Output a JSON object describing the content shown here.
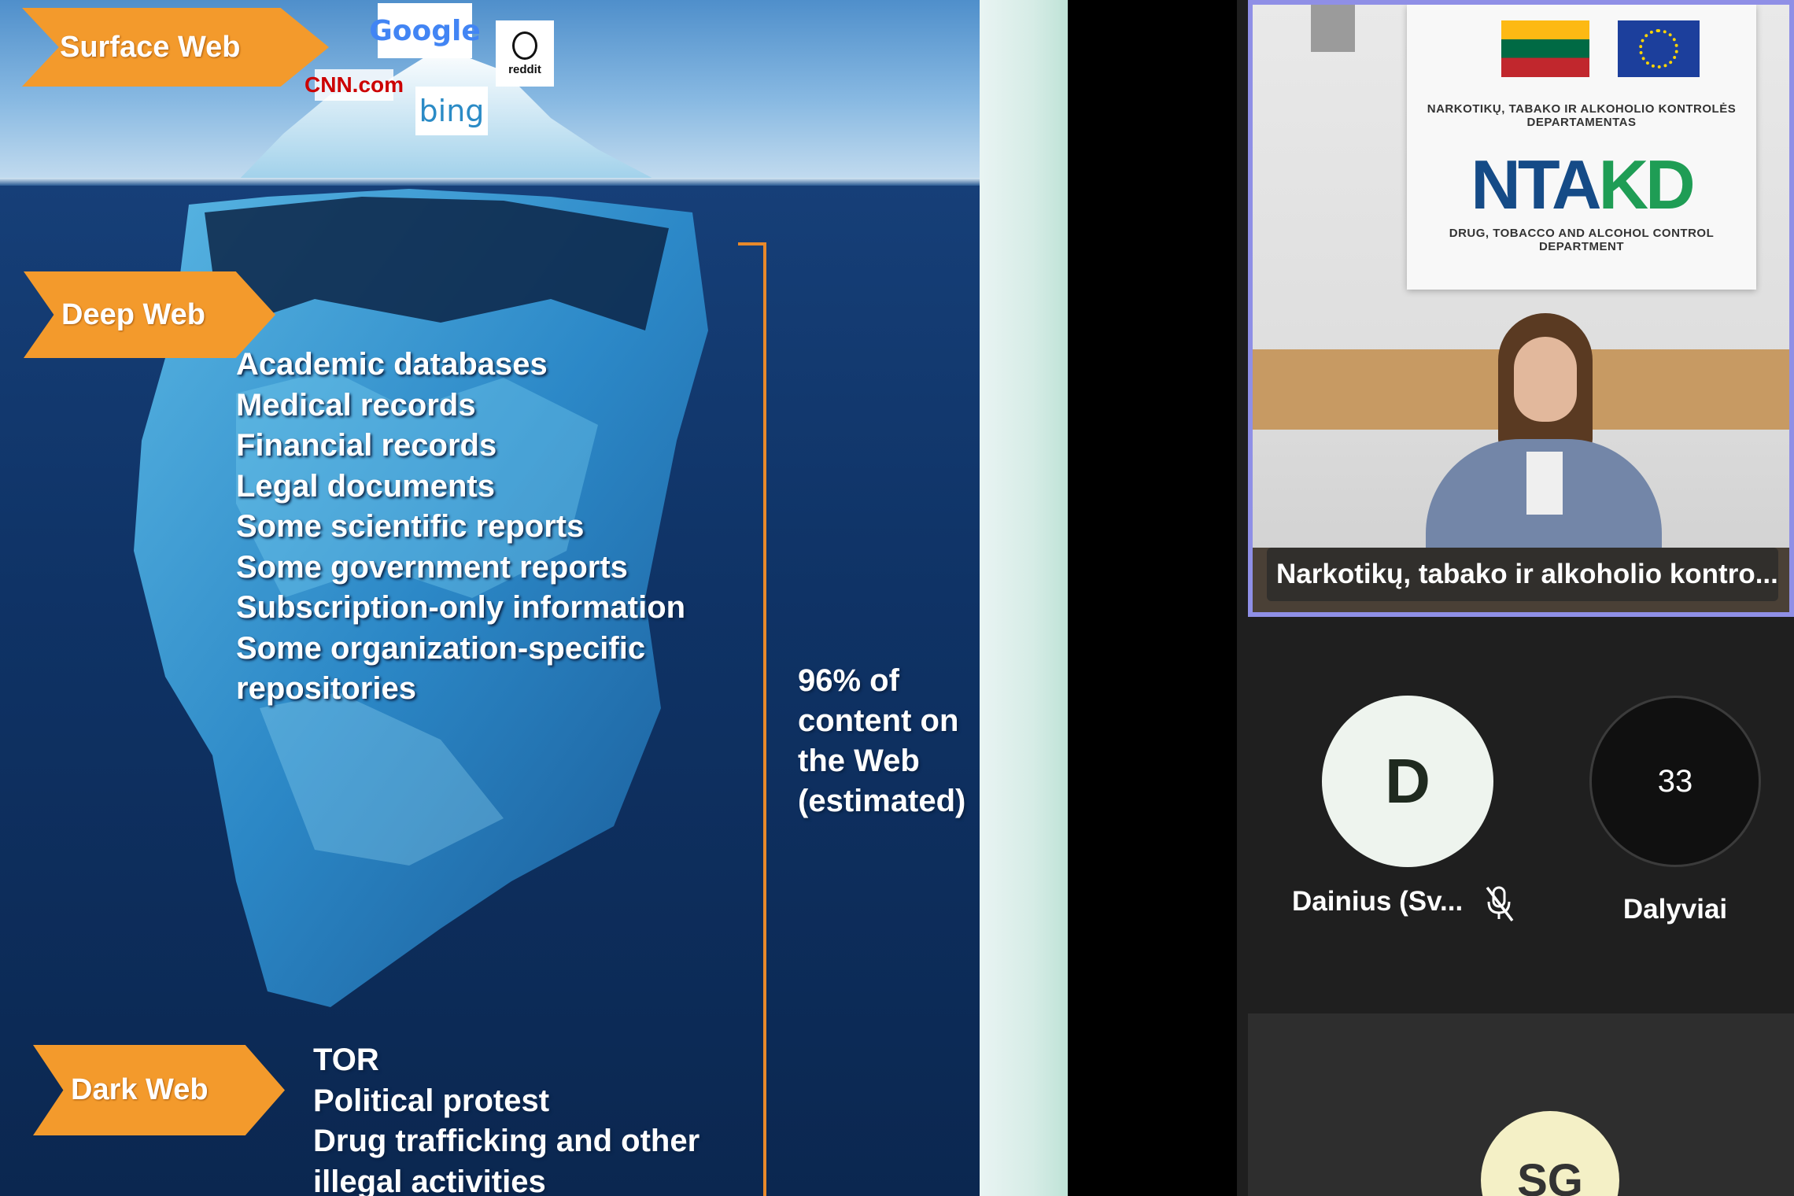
{
  "slide": {
    "surface_label": "Surface Web",
    "deep_label": "Deep Web",
    "dark_label": "Dark Web",
    "logos": {
      "google": "Google",
      "reddit": "reddit",
      "cnn": "CNN.com",
      "bing": "bing"
    },
    "deep_items": [
      "Academic databases",
      "Medical records",
      "Financial records",
      "Legal documents",
      "Some scientific reports",
      "Some government reports",
      "Subscription-only information",
      "Some organization-specific",
      "repositories"
    ],
    "dark_items": [
      "TOR",
      "Political protest",
      "Drug trafficking and other",
      "illegal activities"
    ],
    "bracket_note": "96% of content on the Web (estimated)",
    "arrow_color": "#f39a2c"
  },
  "video": {
    "banner": {
      "top_text": "NARKOTIKŲ, TABAKO IR ALKOHOLIO KONTROLĖS DEPARTAMENTAS",
      "logo_main": "NTA",
      "logo_accent": "KD",
      "bottom_text": "DRUG, TOBACCO AND ALCOHOL CONTROL DEPARTMENT"
    },
    "speaker_name": "Narkotikų, tabako ir alkoholio kontro..."
  },
  "participants": {
    "avatar_d": "D",
    "name_d": "Dainius (Sv...",
    "count": "33",
    "count_label": "Dalyviai",
    "avatar_sg": "SG",
    "active_speaker_color": "#8f8fe6"
  }
}
